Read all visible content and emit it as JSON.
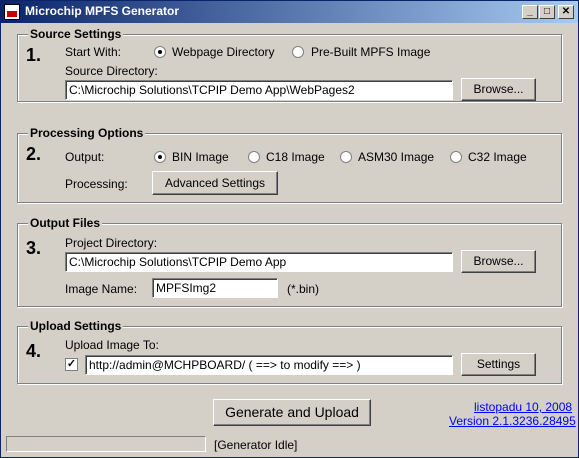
{
  "window": {
    "title": "Microchip MPFS Generator",
    "minimize": "_",
    "maximize": "□",
    "close": "✕"
  },
  "source": {
    "group_title": "Source Settings",
    "step": "1.",
    "start_with_label": "Start With:",
    "option_webpage": "Webpage Directory",
    "option_prebuilt": "Pre-Built MPFS Image",
    "selected": "Webpage Directory",
    "dir_label": "Source Directory:",
    "dir_value": "C:\\Microchip Solutions\\TCPIP Demo App\\WebPages2",
    "browse": "Browse..."
  },
  "processing": {
    "group_title": "Processing Options",
    "step": "2.",
    "output_label": "Output:",
    "options": [
      "BIN Image",
      "C18 Image",
      "ASM30 Image",
      "C32 Image"
    ],
    "selected": "BIN Image",
    "processing_label": "Processing:",
    "advanced": "Advanced Settings"
  },
  "output": {
    "group_title": "Output Files",
    "step": "3.",
    "project_label": "Project Directory:",
    "project_value": "C:\\Microchip Solutions\\TCPIP Demo App",
    "browse": "Browse...",
    "image_name_label": "Image Name:",
    "image_name_value": "MPFSImg2",
    "ext": "(*.bin)"
  },
  "upload": {
    "group_title": "Upload Settings",
    "step": "4.",
    "upload_label": "Upload Image To:",
    "checked": true,
    "check_mark": "✓",
    "url_value": "http://admin@MCHPBOARD/          ( ==> to modify ==> )",
    "settings": "Settings"
  },
  "footer": {
    "generate": "Generate and Upload",
    "date_link": "listopadu 10, 2008",
    "version_link": "Version 2.1.3236.28495",
    "status": "[Generator Idle]"
  }
}
